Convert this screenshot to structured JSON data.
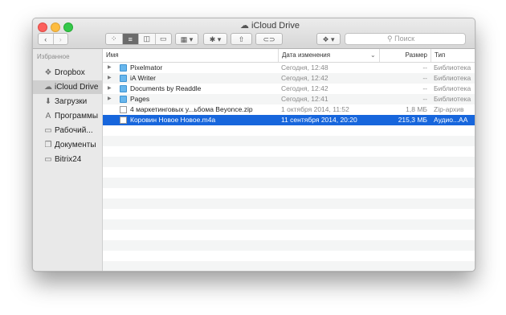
{
  "window": {
    "title": "iCloud Drive"
  },
  "toolbar": {
    "back_icon": "chevron-left-icon",
    "forward_icon": "chevron-right-icon",
    "view_modes": [
      "icon-view",
      "list-view",
      "column-view",
      "cover-flow-view"
    ],
    "arrange_icon": "grid-arrange-icon",
    "action_icon": "gear-icon",
    "share_icon": "share-icon",
    "tag_icon": "tag-icon",
    "dropbox_icon": "dropbox-icon",
    "search_placeholder": "Поиск"
  },
  "sidebar": {
    "heading": "Избранное",
    "items": [
      {
        "label": "Dropbox",
        "icon": "dropbox-icon"
      },
      {
        "label": "iCloud Drive",
        "icon": "cloud-icon",
        "selected": true
      },
      {
        "label": "Загрузки",
        "icon": "download-icon"
      },
      {
        "label": "Программы",
        "icon": "applications-icon"
      },
      {
        "label": "Рабочий...",
        "icon": "desktop-icon"
      },
      {
        "label": "Документы",
        "icon": "documents-icon"
      },
      {
        "label": "Bitrix24",
        "icon": "folder-icon"
      }
    ]
  },
  "columns": {
    "name": "Имя",
    "date": "Дата изменения",
    "size": "Размер",
    "kind": "Тип"
  },
  "files": [
    {
      "name": "Pixelmator",
      "date": "Сегодня, 12:48",
      "size": "--",
      "kind": "Библиотека",
      "folder": true
    },
    {
      "name": "iA Writer",
      "date": "Сегодня, 12:42",
      "size": "--",
      "kind": "Библиотека",
      "folder": true
    },
    {
      "name": "Documents by Readdle",
      "date": "Сегодня, 12:42",
      "size": "--",
      "kind": "Библиотека",
      "folder": true
    },
    {
      "name": "Pages",
      "date": "Сегодня, 12:41",
      "size": "--",
      "kind": "Библиотека",
      "folder": true
    },
    {
      "name": "4 маркетинговых у...ьбома Beyonce.zip",
      "date": "1 октября 2014, 11:52",
      "size": "1,8 МБ",
      "kind": "Zip-архив",
      "folder": false
    },
    {
      "name": "Коровин Новое Новое.m4a",
      "date": "11 сентября 2014, 20:20",
      "size": "215,3 МБ",
      "kind": "Аудио...АА",
      "folder": false,
      "selected": true
    }
  ],
  "colors": {
    "selection": "#1766dc",
    "folder": "#68b6ec",
    "sidebar_bg": "#e9e9e9"
  }
}
